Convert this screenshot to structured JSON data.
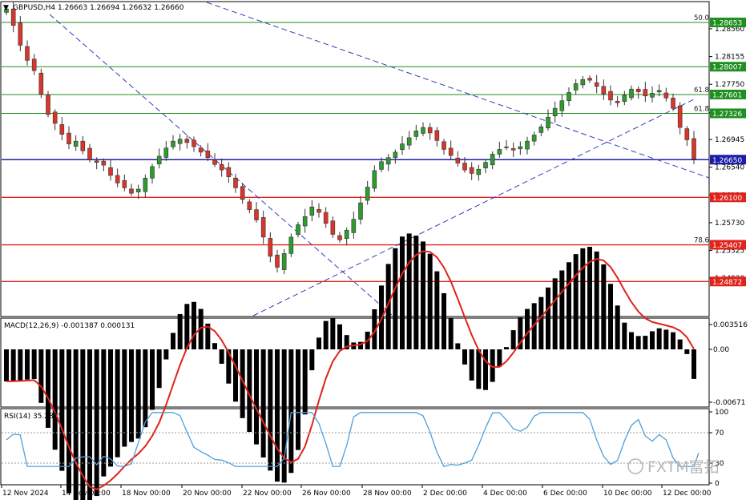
{
  "header": {
    "symbol": "GBPUSD,H4",
    "ohlc": "1.26663 1.26694 1.26632 1.26660"
  },
  "macd_header": "MACD(12,26,9) -0.001387 0.000131",
  "rsi_header": "RSI(14) 35.2815",
  "watermark": "FXTM富拓",
  "colors": {
    "candle_up": "#2e9b2e",
    "candle_down": "#d9352a",
    "green_line": "#1f8f1f",
    "red_line": "#e0231b",
    "blue_line": "#1c1ca8",
    "trend": "#3a3ab8",
    "macd_signal": "#e0231b",
    "rsi_line": "#4f9fd8"
  },
  "chart_data": [
    {
      "type": "candlestick",
      "title": "GBPUSD,H4",
      "y_ticks": [
        "1.28560",
        "1.28155",
        "1.27750",
        "1.27335",
        "1.26945",
        "1.26540",
        "1.26130",
        "1.25730",
        "1.25325",
        "1.24920"
      ],
      "ylim": [
        1.2485,
        1.291
      ],
      "x_ticks": [
        "12 Nov 2024",
        "14 Nov 00:00",
        "18 Nov 00:00",
        "20 Nov 00:00",
        "22 Nov 00:00",
        "26 Nov 00:00",
        "28 Nov 00:00",
        "2 Dec 00:00",
        "4 Dec 00:00",
        "6 Dec 00:00",
        "10 Dec 00:00",
        "12 Dec 00:00"
      ],
      "levels": [
        {
          "value": 1.28653,
          "label": "1.28653",
          "fib": "50.0",
          "kind": "green"
        },
        {
          "value": 1.28007,
          "label": "1.28007",
          "fib": "",
          "kind": "green"
        },
        {
          "value": 1.27601,
          "label": "1.27601",
          "fib": "61.8",
          "kind": "green"
        },
        {
          "value": 1.27326,
          "label": "1.27326",
          "fib": "61.8",
          "kind": "green"
        },
        {
          "value": 1.2665,
          "label": "1.26650",
          "fib": "",
          "kind": "blue"
        },
        {
          "value": 1.261,
          "label": "1.26100",
          "fib": "",
          "kind": "red"
        },
        {
          "value": 1.25407,
          "label": "1.25407",
          "fib": "78.6",
          "kind": "red"
        },
        {
          "value": 1.24872,
          "label": "1.24872",
          "fib": "",
          "kind": "red"
        }
      ],
      "close_path": [
        1.2885,
        1.2861,
        1.2832,
        1.281,
        1.2795,
        1.276,
        1.2731,
        1.2718,
        1.2702,
        1.2688,
        1.2692,
        1.2678,
        1.2665,
        1.2661,
        1.2657,
        1.2642,
        1.2631,
        1.2624,
        1.2616,
        1.2622,
        1.2638,
        1.2655,
        1.267,
        1.2682,
        1.2692,
        1.2695,
        1.269,
        1.2684,
        1.2676,
        1.2668,
        1.2658,
        1.265,
        1.264,
        1.2624,
        1.2607,
        1.2592,
        1.2577,
        1.2552,
        1.2524,
        1.2508,
        1.2528,
        1.2552,
        1.257,
        1.2582,
        1.2596,
        1.2588,
        1.2572,
        1.2556,
        1.2548,
        1.2562,
        1.2578,
        1.2602,
        1.2625,
        1.2649,
        1.2662,
        1.2668,
        1.2676,
        1.2688,
        1.2697,
        1.2707,
        1.2712,
        1.2704,
        1.2693,
        1.268,
        1.2671,
        1.266,
        1.265,
        1.2645,
        1.2651,
        1.2661,
        1.2673,
        1.268,
        1.2683,
        1.2679,
        1.2684,
        1.2692,
        1.2701,
        1.2713,
        1.2727,
        1.274,
        1.2751,
        1.2763,
        1.2776,
        1.2782,
        1.2781,
        1.2772,
        1.2761,
        1.2752,
        1.2748,
        1.2759,
        1.2768,
        1.2764,
        1.2758,
        1.2762,
        1.2766,
        1.2755,
        1.274,
        1.2712,
        1.2694,
        1.2666
      ]
    },
    {
      "type": "bar",
      "title": "MACD(12,26,9)",
      "main": -0.001387,
      "signal": 0.000131,
      "y_ticks": [
        "0.003516",
        "0.00",
        "-0.00671"
      ]
    },
    {
      "type": "line",
      "title": "RSI(14)",
      "value": 35.2815,
      "y_ticks": [
        "100",
        "70",
        "30",
        "0"
      ]
    }
  ]
}
